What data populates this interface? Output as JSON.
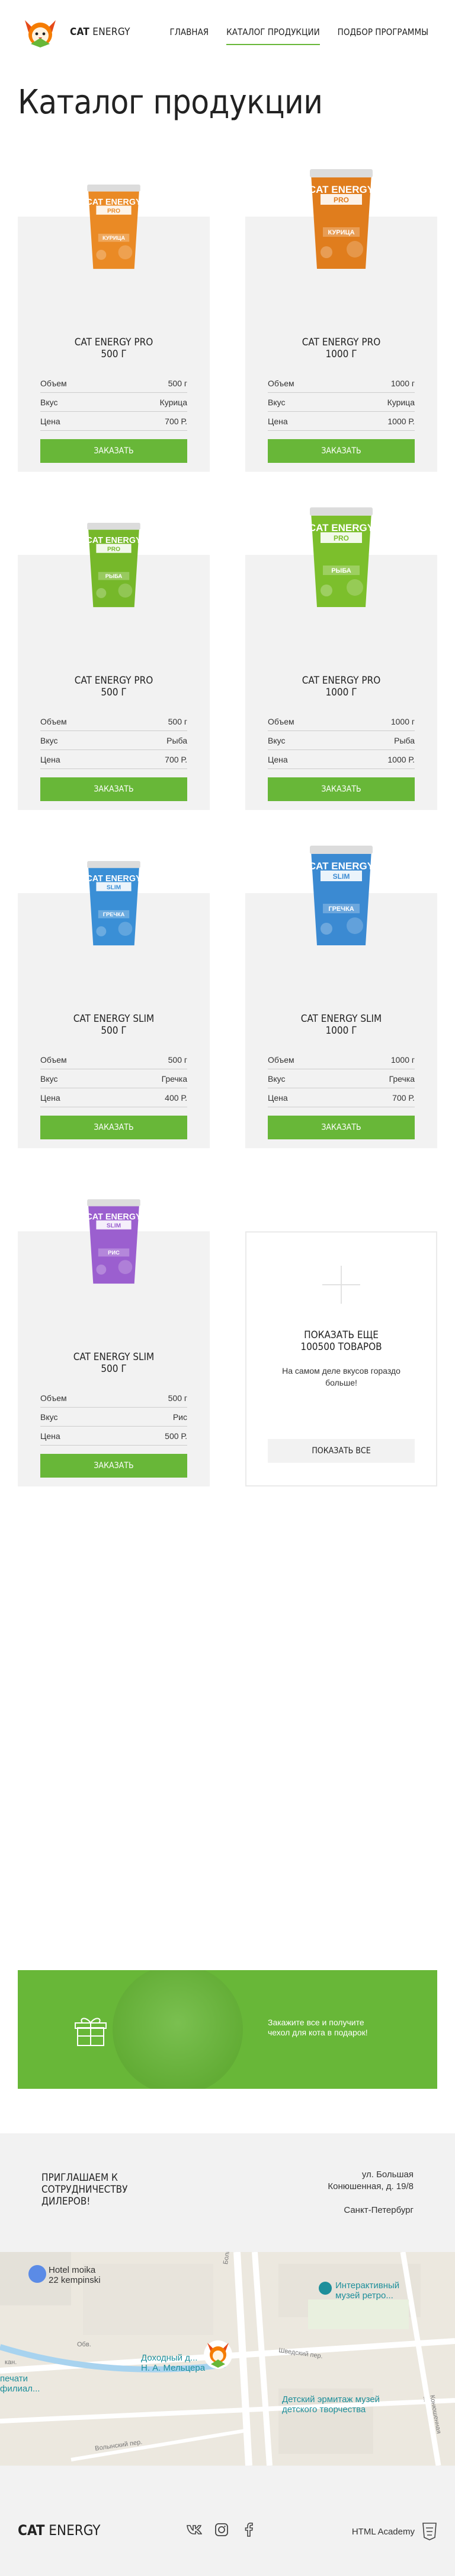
{
  "header": {
    "logo_bold": "CAT",
    "logo_light": " ENERGY",
    "nav": [
      {
        "label": "Главная",
        "active": false
      },
      {
        "label": "Каталог продукции",
        "active": true
      },
      {
        "label": "Подбор программы",
        "active": false
      }
    ]
  },
  "page_title": "Каталог продукции",
  "spec_labels": {
    "volume": "Объем",
    "flavor": "Вкус",
    "price": "Цена"
  },
  "products": [
    {
      "title_line1": "Cat Energy Pro",
      "title_line2": "500 г",
      "volume": "500 г",
      "flavor": "Курица",
      "price": "700 Р.",
      "order_label": "Заказать",
      "pack_brand": "CAT ENERGY",
      "pack_badge": "PRO",
      "pack_flavor": "КУРИЦА",
      "color": "#ea8a25"
    },
    {
      "title_line1": "Cat Energy Pro",
      "title_line2": "1000 г",
      "volume": "1000 г",
      "flavor": "Курица",
      "price": "1000 Р.",
      "order_label": "Заказать",
      "pack_brand": "CAT ENERGY",
      "pack_badge": "PRO",
      "pack_flavor": "КУРИЦА",
      "color": "#e07d1d"
    },
    {
      "title_line1": "Cat Energy Pro",
      "title_line2": "500 г",
      "volume": "500 г",
      "flavor": "Рыба",
      "price": "700 Р.",
      "order_label": "Заказать",
      "pack_brand": "CAT ENERGY",
      "pack_badge": "PRO",
      "pack_flavor": "РЫБА",
      "color": "#76b82a"
    },
    {
      "title_line1": "Cat Energy Pro",
      "title_line2": "1000 г",
      "volume": "1000 г",
      "flavor": "Рыба",
      "price": "1000 Р.",
      "order_label": "Заказать",
      "pack_brand": "CAT ENERGY",
      "pack_badge": "PRO",
      "pack_flavor": "РЫБА",
      "color": "#7cbf2c"
    },
    {
      "title_line1": "Cat Energy Slim",
      "title_line2": "500 г",
      "volume": "500 г",
      "flavor": "Гречка",
      "price": "400 Р.",
      "order_label": "Заказать",
      "pack_brand": "CAT ENERGY",
      "pack_badge": "SLIM",
      "pack_flavor": "ГРЕЧКА",
      "color": "#3a8fd6"
    },
    {
      "title_line1": "Cat Energy Slim",
      "title_line2": "1000 г",
      "volume": "1000 г",
      "flavor": "Гречка",
      "price": "700 Р.",
      "order_label": "Заказать",
      "pack_brand": "CAT ENERGY",
      "pack_badge": "SLIM",
      "pack_flavor": "ГРЕЧКА",
      "color": "#3b8ad2"
    },
    {
      "title_line1": "Cat Energy Slim",
      "title_line2": "500 г",
      "volume": "500 г",
      "flavor": "Рис",
      "price": "500 Р.",
      "order_label": "Заказать",
      "pack_brand": "CAT ENERGY",
      "pack_badge": "SLIM",
      "pack_flavor": "РИС",
      "color": "#9b5fcf"
    }
  ],
  "more": {
    "title_line1": "Показать еще",
    "title_line2": "100500 товаров",
    "subtitle": "На самом деле вкусов гораздо больше!",
    "button_label": "Показать все"
  },
  "promo": {
    "text": "Закажите все и получите чехол для кота в подарок!"
  },
  "dealers": {
    "title": "Приглашаем к сотрудничеству дилеров!",
    "address_line1": "ул. Большая",
    "address_line2": "Конюшенная, д. 19/8",
    "address_line3": "Санкт-Петербург"
  },
  "map": {
    "hotel_line1": "Hotel moika",
    "hotel_line2": "22 kempinski",
    "museum_line1": "Интерактивный",
    "museum_line2": "музей ретро...",
    "house_line1": "Доходный д...",
    "house_line2": "Н. А. Мельцера",
    "hermitage_line1": "Детский эрмитаж музей",
    "hermitage_line2": "детского творчества",
    "left_line1": "печати",
    "left_line2": "филиал...",
    "street_bolshaya": "Большая Кон...",
    "street_shvedsky": "Шведский пер.",
    "street_volynsky": "Волынский пер.",
    "street_konyush": "Конюшенная ...",
    "street_obv": "Обв.",
    "street_kan": "кан."
  },
  "footer": {
    "logo_bold": "CAT",
    "logo_light": " ENERGY",
    "academy": "HTML Academy"
  },
  "colors": {
    "accent": "#68b738",
    "card_bg": "#f2f2f2"
  }
}
